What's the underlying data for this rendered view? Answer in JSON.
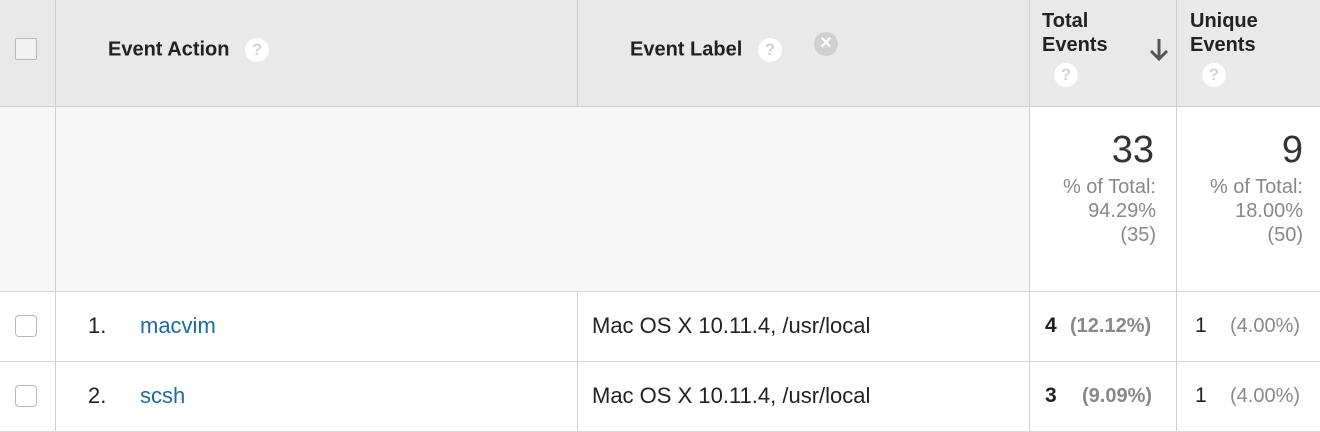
{
  "header": {
    "event_action": "Event Action",
    "event_label": "Event Label",
    "total_events_line1": "Total",
    "total_events_line2": "Events",
    "unique_events_line1": "Unique",
    "unique_events_line2": "Events",
    "help_glyph": "?",
    "clear_glyph": "×"
  },
  "summary": {
    "total_events": {
      "value": "33",
      "pct_label": "% of Total:",
      "pct": "94.29%",
      "of": "(35)"
    },
    "unique_events": {
      "value": "9",
      "pct_label": "% of Total:",
      "pct": "18.00%",
      "of": "(50)"
    }
  },
  "rows": [
    {
      "rank": "1.",
      "action": "macvim",
      "label": "Mac OS X 10.11.4, /usr/local",
      "total": "4",
      "total_pct": "(12.12%)",
      "unique": "1",
      "unique_pct": "(4.00%)"
    },
    {
      "rank": "2.",
      "action": "scsh",
      "label": "Mac OS X 10.11.4, /usr/local",
      "total": "3",
      "total_pct": "(9.09%)",
      "unique": "1",
      "unique_pct": "(4.00%)"
    }
  ],
  "colors": {
    "link": "#1a6aa6",
    "header_bg": "#e9e9e9",
    "summary_bg": "#f6f6f6"
  }
}
